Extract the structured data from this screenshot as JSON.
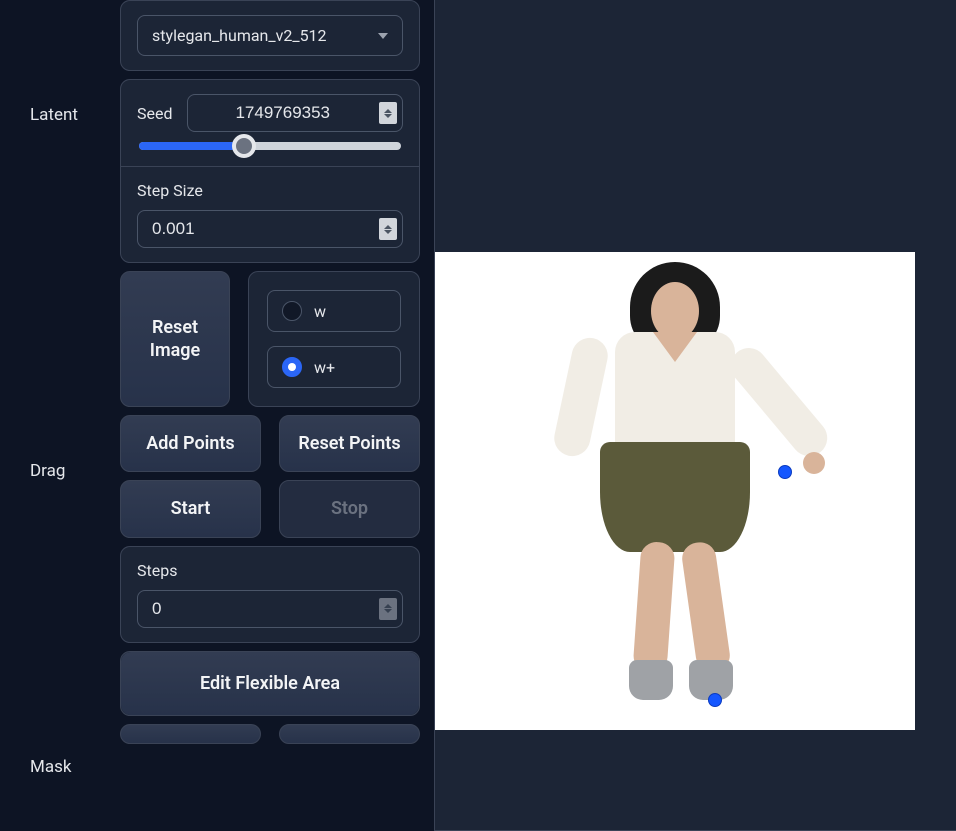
{
  "model": {
    "selected": "stylegan_human_v2_512"
  },
  "sections": {
    "latent": "Latent",
    "drag": "Drag",
    "mask": "Mask"
  },
  "latent": {
    "seed_label": "Seed",
    "seed_value": "1749769353",
    "seed_slider_percent": 40,
    "step_size_label": "Step Size",
    "step_size_value": "0.001"
  },
  "buttons": {
    "reset_image": "Reset Image",
    "add_points": "Add Points",
    "reset_points": "Reset Points",
    "start": "Start",
    "stop": "Stop",
    "edit_flexible_area": "Edit Flexible Area"
  },
  "latent_space": {
    "options": [
      {
        "key": "w",
        "label": "w",
        "selected": false
      },
      {
        "key": "w_plus",
        "label": "w+",
        "selected": true
      }
    ]
  },
  "drag": {
    "steps_label": "Steps",
    "steps_value": "0"
  },
  "image": {
    "points": [
      {
        "id": "p1"
      },
      {
        "id": "p2"
      }
    ]
  }
}
